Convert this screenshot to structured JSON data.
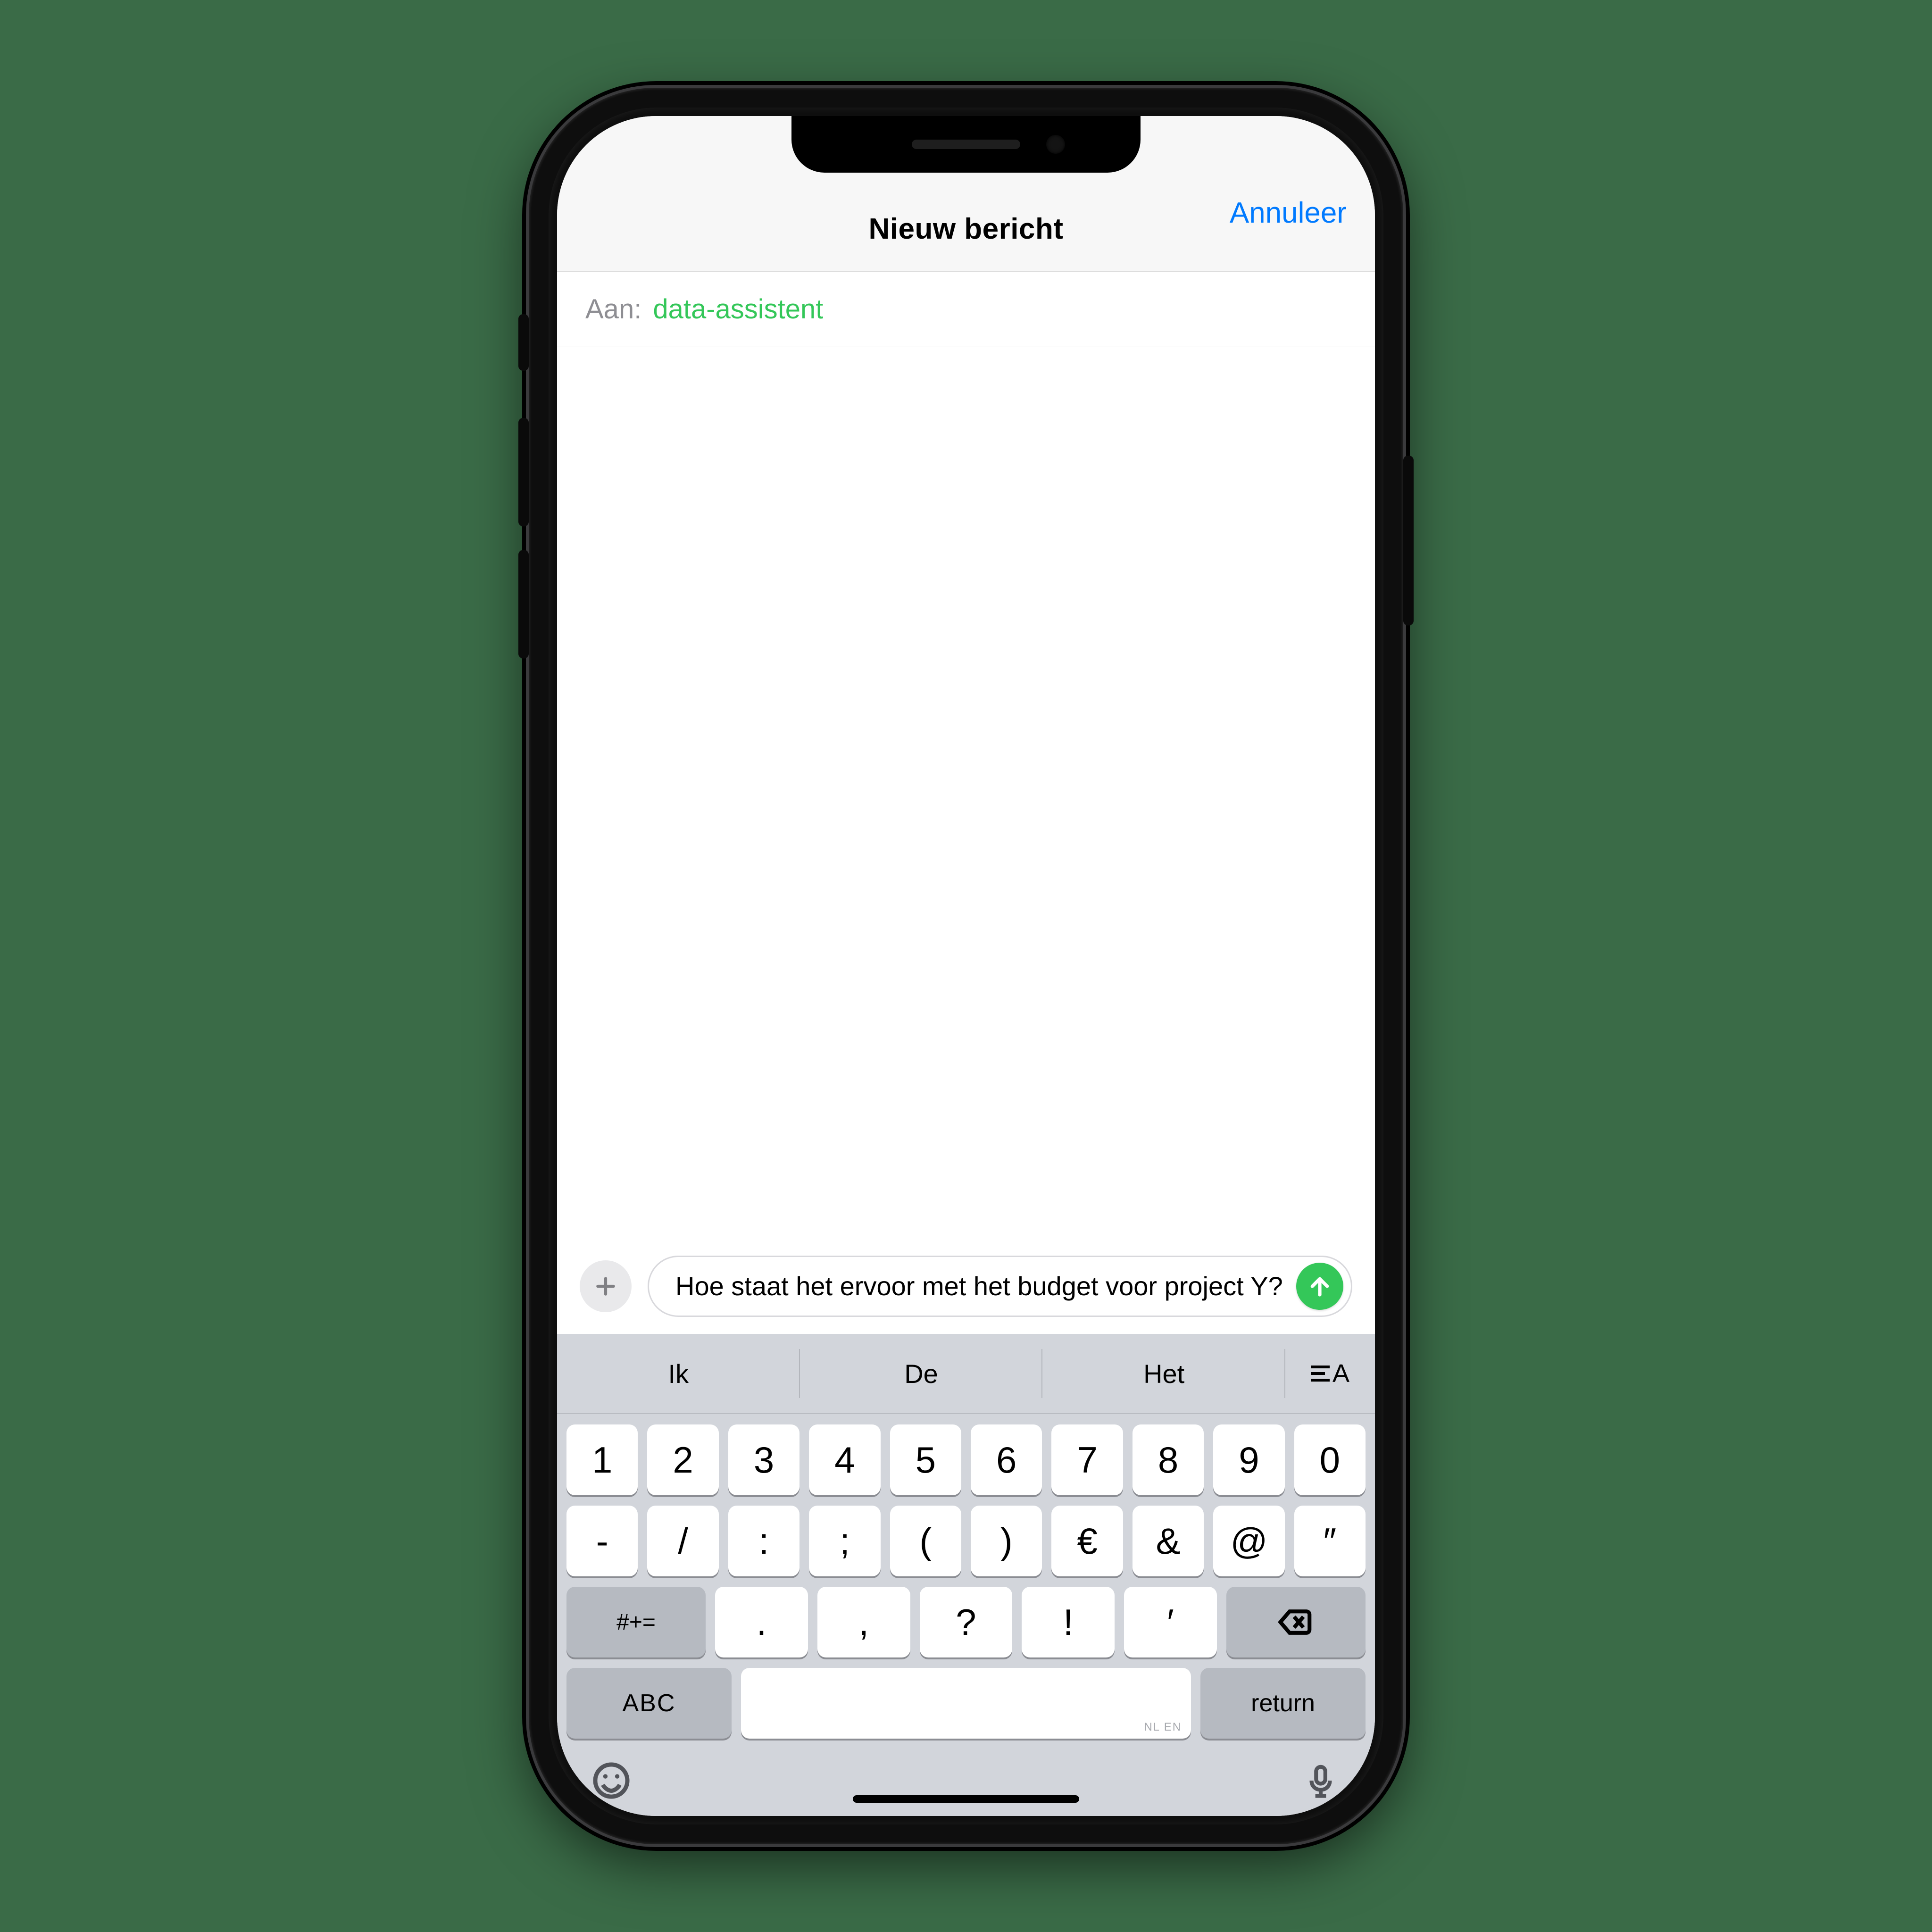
{
  "header": {
    "title": "Nieuw bericht",
    "cancel": "Annuleer"
  },
  "to": {
    "label": "Aan:",
    "recipient": "data-assistent"
  },
  "compose": {
    "text": "Hoe staat het ervoor met het budget voor project Y?"
  },
  "suggestions": [
    "Ik",
    "De",
    "Het"
  ],
  "keys": {
    "row1": [
      "1",
      "2",
      "3",
      "4",
      "5",
      "6",
      "7",
      "8",
      "9",
      "0"
    ],
    "row2": [
      "-",
      "/",
      ":",
      ";",
      "(",
      ")",
      "€",
      "&",
      "@",
      "″"
    ],
    "row3": {
      "shift": "#+=",
      "mid": [
        ".",
        ",",
        "?",
        "!",
        "′"
      ]
    },
    "row4": {
      "abc": "ABC",
      "ret": "return",
      "lang": "NL EN"
    }
  }
}
